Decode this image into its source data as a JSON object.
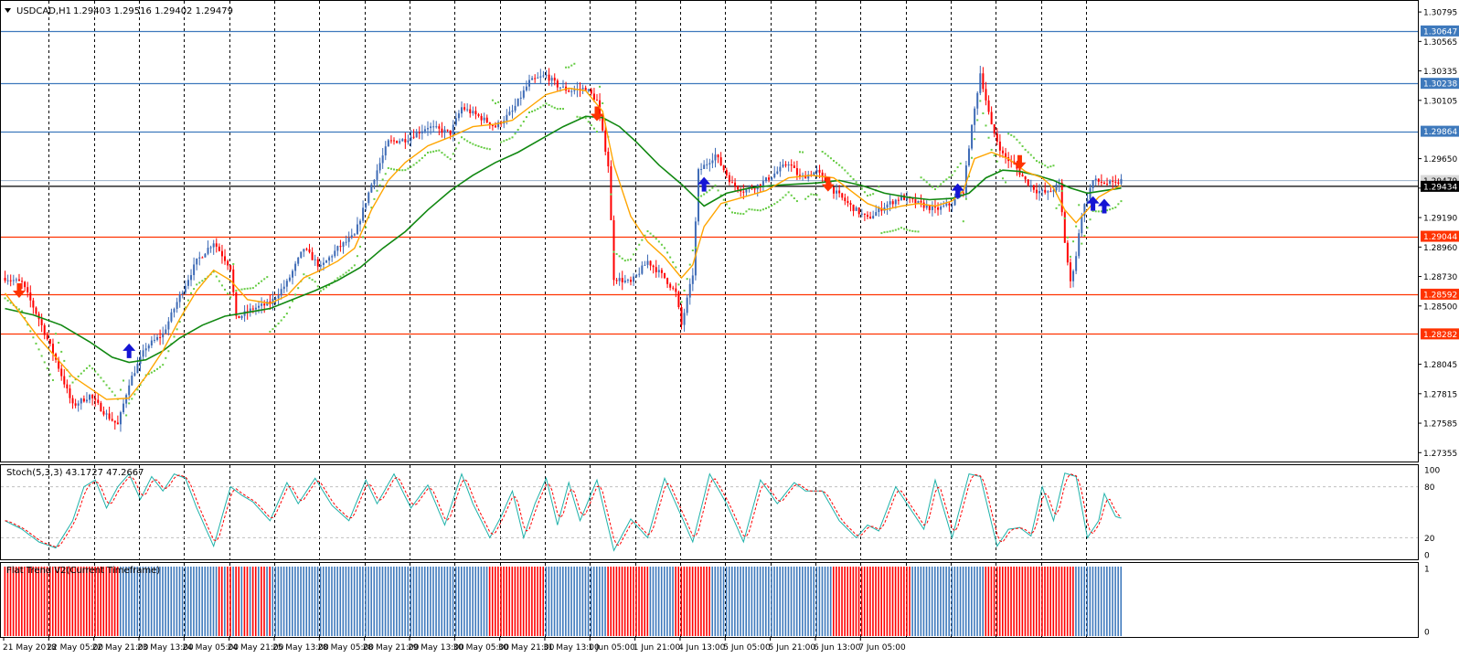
{
  "window": {
    "title": "USDCAD,H1",
    "ohlc": "1.29403 1.29516 1.29402 1.29479",
    "collapse_icon": "triangle-down-icon"
  },
  "colors": {
    "background": "#ffffff",
    "bull_candle": "#3e6bb6",
    "bear_candle": "#ff0000",
    "ma_fast": "#ffa500",
    "ma_slow": "#118811",
    "sar": "#66cc44",
    "resistance": "#3e79bc",
    "support": "#ff3300",
    "bid_line": "#000000",
    "arrow_up": "#1515d4",
    "arrow_down": "#ff3300",
    "stoch_main": "#20b2aa",
    "stoch_signal": "#ff0000",
    "flat_up": "#3e79bc",
    "flat_down": "#ff0000"
  },
  "chart_data": [
    {
      "type": "candlestick",
      "name": "USDCAD H1",
      "price_scale": [
        "1.30795",
        "1.30565",
        "1.30335",
        "1.30105",
        "1.29650",
        "1.29420",
        "1.29190",
        "1.28960",
        "1.28730",
        "1.28500",
        "1.28045",
        "1.27815",
        "1.27585",
        "1.27355"
      ],
      "ylim": [
        1.273,
        1.3086
      ],
      "horizontal_levels": [
        {
          "label": "1.30647",
          "value": 1.30647,
          "kind": "resistance"
        },
        {
          "label": "1.30238",
          "value": 1.30238,
          "kind": "resistance"
        },
        {
          "label": "1.29864",
          "value": 1.29864,
          "kind": "resistance"
        },
        {
          "label": "1.29044",
          "value": 1.29044,
          "kind": "support"
        },
        {
          "label": "1.28592",
          "value": 1.28592,
          "kind": "support"
        },
        {
          "label": "1.28282",
          "value": 1.28282,
          "kind": "support"
        }
      ],
      "bid": {
        "label": "1.29434",
        "value": 1.29434
      },
      "ask": {
        "label": "1.29479",
        "value": 1.29479
      },
      "x_labels": [
        "21 May 2018",
        "22 May 05:00",
        "22 May 21:00",
        "23 May 13:00",
        "24 May 05:00",
        "24 May 21:00",
        "25 May 13:00",
        "28 May 05:00",
        "28 May 21:00",
        "29 May 13:00",
        "30 May 05:00",
        "30 May 21:00",
        "31 May 13:00",
        "1 Jun 05:00",
        "1 Jun 21:00",
        "4 Jun 13:00",
        "5 Jun 05:00",
        "5 Jun 21:00",
        "6 Jun 13:00",
        "7 Jun 05:00"
      ],
      "close_path": [
        [
          0,
          1.2872
        ],
        [
          6,
          1.2868
        ],
        [
          12,
          1.284
        ],
        [
          18,
          1.2808
        ],
        [
          24,
          1.2772
        ],
        [
          30,
          1.278
        ],
        [
          36,
          1.2765
        ],
        [
          40,
          1.2757
        ],
        [
          44,
          1.279
        ],
        [
          50,
          1.2818
        ],
        [
          56,
          1.2828
        ],
        [
          62,
          1.2858
        ],
        [
          68,
          1.2885
        ],
        [
          74,
          1.29
        ],
        [
          80,
          1.288
        ],
        [
          82,
          1.284
        ],
        [
          88,
          1.2848
        ],
        [
          94,
          1.2852
        ],
        [
          100,
          1.2868
        ],
        [
          106,
          1.2895
        ],
        [
          112,
          1.288
        ],
        [
          118,
          1.2895
        ],
        [
          124,
          1.2905
        ],
        [
          130,
          1.2945
        ],
        [
          136,
          1.2978
        ],
        [
          142,
          1.298
        ],
        [
          150,
          1.299
        ],
        [
          158,
          1.2985
        ],
        [
          162,
          1.3005
        ],
        [
          168,
          1.2998
        ],
        [
          174,
          1.299
        ],
        [
          180,
          1.3002
        ],
        [
          186,
          1.3025
        ],
        [
          192,
          1.303
        ],
        [
          196,
          1.3022
        ],
        [
          200,
          1.3018
        ],
        [
          206,
          1.302
        ],
        [
          210,
          1.301
        ],
        [
          214,
          1.296
        ],
        [
          216,
          1.2872
        ],
        [
          222,
          1.2868
        ],
        [
          228,
          1.2885
        ],
        [
          234,
          1.2872
        ],
        [
          238,
          1.286
        ],
        [
          240,
          1.2835
        ],
        [
          244,
          1.2875
        ],
        [
          246,
          1.2955
        ],
        [
          252,
          1.2968
        ],
        [
          258,
          1.2945
        ],
        [
          262,
          1.294
        ],
        [
          268,
          1.2945
        ],
        [
          274,
          1.2955
        ],
        [
          278,
          1.2962
        ],
        [
          282,
          1.295
        ],
        [
          288,
          1.2955
        ],
        [
          294,
          1.294
        ],
        [
          300,
          1.2928
        ],
        [
          306,
          1.2918
        ],
        [
          312,
          1.2928
        ],
        [
          318,
          1.2935
        ],
        [
          324,
          1.293
        ],
        [
          330,
          1.2925
        ],
        [
          336,
          1.293
        ],
        [
          340,
          1.294
        ],
        [
          342,
          1.2975
        ],
        [
          346,
          1.3032
        ],
        [
          350,
          1.299
        ],
        [
          354,
          1.2968
        ],
        [
          358,
          1.296
        ],
        [
          362,
          1.2948
        ],
        [
          366,
          1.294
        ],
        [
          370,
          1.2938
        ],
        [
          374,
          1.2945
        ],
        [
          376,
          1.29
        ],
        [
          378,
          1.2868
        ],
        [
          380,
          1.289
        ],
        [
          382,
          1.2922
        ],
        [
          386,
          1.2948
        ],
        [
          390,
          1.2946
        ],
        [
          394,
          1.2945
        ],
        [
          396,
          1.2948
        ]
      ],
      "ma_fast_path": [
        [
          0,
          1.286
        ],
        [
          12,
          1.2825
        ],
        [
          24,
          1.2795
        ],
        [
          36,
          1.2777
        ],
        [
          44,
          1.2778
        ],
        [
          50,
          1.2795
        ],
        [
          56,
          1.2815
        ],
        [
          62,
          1.284
        ],
        [
          68,
          1.2862
        ],
        [
          74,
          1.2878
        ],
        [
          80,
          1.287
        ],
        [
          86,
          1.2855
        ],
        [
          94,
          1.2852
        ],
        [
          100,
          1.2858
        ],
        [
          106,
          1.2872
        ],
        [
          112,
          1.2878
        ],
        [
          118,
          1.2885
        ],
        [
          124,
          1.2895
        ],
        [
          130,
          1.2925
        ],
        [
          136,
          1.2948
        ],
        [
          142,
          1.2962
        ],
        [
          150,
          1.2975
        ],
        [
          158,
          1.2982
        ],
        [
          166,
          1.299
        ],
        [
          174,
          1.2992
        ],
        [
          180,
          1.2995
        ],
        [
          186,
          1.3005
        ],
        [
          192,
          1.3015
        ],
        [
          200,
          1.302
        ],
        [
          206,
          1.3018
        ],
        [
          212,
          1.3002
        ],
        [
          216,
          1.296
        ],
        [
          222,
          1.292
        ],
        [
          228,
          1.29
        ],
        [
          234,
          1.2888
        ],
        [
          240,
          1.2872
        ],
        [
          244,
          1.2882
        ],
        [
          248,
          1.2912
        ],
        [
          254,
          1.293
        ],
        [
          262,
          1.2935
        ],
        [
          270,
          1.294
        ],
        [
          278,
          1.295
        ],
        [
          286,
          1.2952
        ],
        [
          294,
          1.295
        ],
        [
          300,
          1.294
        ],
        [
          306,
          1.293
        ],
        [
          312,
          1.2925
        ],
        [
          318,
          1.2928
        ],
        [
          324,
          1.293
        ],
        [
          330,
          1.2928
        ],
        [
          336,
          1.2932
        ],
        [
          340,
          1.294
        ],
        [
          344,
          1.2965
        ],
        [
          350,
          1.297
        ],
        [
          356,
          1.2965
        ],
        [
          362,
          1.2955
        ],
        [
          368,
          1.295
        ],
        [
          372,
          1.2942
        ],
        [
          376,
          1.2925
        ],
        [
          380,
          1.2915
        ],
        [
          384,
          1.2925
        ],
        [
          388,
          1.2935
        ],
        [
          392,
          1.294
        ],
        [
          396,
          1.2944
        ]
      ],
      "ma_slow_path": [
        [
          0,
          1.2848
        ],
        [
          10,
          1.2843
        ],
        [
          20,
          1.2835
        ],
        [
          30,
          1.2822
        ],
        [
          38,
          1.281
        ],
        [
          44,
          1.2806
        ],
        [
          50,
          1.2808
        ],
        [
          56,
          1.2815
        ],
        [
          62,
          1.2825
        ],
        [
          70,
          1.2835
        ],
        [
          78,
          1.2842
        ],
        [
          86,
          1.2845
        ],
        [
          94,
          1.2848
        ],
        [
          102,
          1.2855
        ],
        [
          110,
          1.2862
        ],
        [
          118,
          1.287
        ],
        [
          126,
          1.288
        ],
        [
          134,
          1.2895
        ],
        [
          142,
          1.2908
        ],
        [
          150,
          1.2925
        ],
        [
          158,
          1.294
        ],
        [
          166,
          1.2952
        ],
        [
          174,
          1.2962
        ],
        [
          182,
          1.297
        ],
        [
          190,
          1.298
        ],
        [
          198,
          1.299
        ],
        [
          206,
          1.2998
        ],
        [
          212,
          1.2997
        ],
        [
          218,
          1.299
        ],
        [
          224,
          1.2978
        ],
        [
          232,
          1.296
        ],
        [
          240,
          1.2945
        ],
        [
          248,
          1.2928
        ],
        [
          256,
          1.2938
        ],
        [
          264,
          1.2942
        ],
        [
          272,
          1.2944
        ],
        [
          280,
          1.2945
        ],
        [
          288,
          1.2946
        ],
        [
          296,
          1.2948
        ],
        [
          304,
          1.2944
        ],
        [
          312,
          1.2938
        ],
        [
          320,
          1.2935
        ],
        [
          328,
          1.2933
        ],
        [
          336,
          1.2934
        ],
        [
          342,
          1.2938
        ],
        [
          348,
          1.295
        ],
        [
          354,
          1.2956
        ],
        [
          360,
          1.2955
        ],
        [
          366,
          1.2952
        ],
        [
          372,
          1.2948
        ],
        [
          378,
          1.2942
        ],
        [
          384,
          1.2938
        ],
        [
          390,
          1.294
        ],
        [
          396,
          1.2942
        ]
      ],
      "signal_arrows": [
        {
          "bar": 5,
          "value": 1.2862,
          "dir": "down"
        },
        {
          "bar": 44,
          "value": 1.2815,
          "dir": "up"
        },
        {
          "bar": 210,
          "value": 1.3,
          "dir": "down"
        },
        {
          "bar": 248,
          "value": 1.2945,
          "dir": "up"
        },
        {
          "bar": 292,
          "value": 1.2945,
          "dir": "down"
        },
        {
          "bar": 338,
          "value": 1.294,
          "dir": "up"
        },
        {
          "bar": 360,
          "value": 1.2962,
          "dir": "down"
        },
        {
          "bar": 386,
          "value": 1.293,
          "dir": "up"
        },
        {
          "bar": 390,
          "value": 1.2928,
          "dir": "up"
        }
      ]
    },
    {
      "type": "line",
      "title": "Stoch(5,3,3) 43.1727 47.2667",
      "ylim": [
        0,
        100
      ],
      "levels": [
        "100",
        "80",
        "20",
        "0"
      ],
      "level_values": [
        100,
        80,
        20,
        0
      ],
      "pivots": [
        [
          0,
          40
        ],
        [
          6,
          30
        ],
        [
          12,
          15
        ],
        [
          18,
          8
        ],
        [
          24,
          40
        ],
        [
          28,
          80
        ],
        [
          32,
          88
        ],
        [
          36,
          55
        ],
        [
          40,
          80
        ],
        [
          44,
          95
        ],
        [
          48,
          65
        ],
        [
          52,
          92
        ],
        [
          56,
          75
        ],
        [
          60,
          95
        ],
        [
          64,
          90
        ],
        [
          68,
          55
        ],
        [
          74,
          10
        ],
        [
          80,
          80
        ],
        [
          84,
          70
        ],
        [
          88,
          62
        ],
        [
          94,
          40
        ],
        [
          100,
          85
        ],
        [
          104,
          60
        ],
        [
          110,
          90
        ],
        [
          116,
          58
        ],
        [
          122,
          40
        ],
        [
          128,
          88
        ],
        [
          132,
          60
        ],
        [
          138,
          95
        ],
        [
          144,
          55
        ],
        [
          150,
          82
        ],
        [
          156,
          35
        ],
        [
          162,
          95
        ],
        [
          166,
          60
        ],
        [
          172,
          20
        ],
        [
          176,
          45
        ],
        [
          180,
          75
        ],
        [
          184,
          20
        ],
        [
          188,
          60
        ],
        [
          192,
          90
        ],
        [
          196,
          35
        ],
        [
          200,
          85
        ],
        [
          204,
          40
        ],
        [
          210,
          88
        ],
        [
          216,
          5
        ],
        [
          222,
          42
        ],
        [
          228,
          20
        ],
        [
          234,
          90
        ],
        [
          238,
          60
        ],
        [
          244,
          15
        ],
        [
          250,
          95
        ],
        [
          256,
          60
        ],
        [
          262,
          15
        ],
        [
          268,
          88
        ],
        [
          274,
          60
        ],
        [
          280,
          85
        ],
        [
          284,
          75
        ],
        [
          290,
          75
        ],
        [
          296,
          40
        ],
        [
          302,
          20
        ],
        [
          306,
          35
        ],
        [
          310,
          28
        ],
        [
          316,
          80
        ],
        [
          322,
          50
        ],
        [
          326,
          30
        ],
        [
          330,
          88
        ],
        [
          336,
          20
        ],
        [
          342,
          95
        ],
        [
          346,
          92
        ],
        [
          352,
          10
        ],
        [
          356,
          30
        ],
        [
          360,
          32
        ],
        [
          364,
          22
        ],
        [
          368,
          80
        ],
        [
          372,
          40
        ],
        [
          376,
          96
        ],
        [
          380,
          92
        ],
        [
          384,
          20
        ],
        [
          388,
          40
        ],
        [
          390,
          72
        ],
        [
          394,
          45
        ],
        [
          396,
          43
        ]
      ]
    },
    {
      "type": "bar",
      "title": "Flat Trend V2(Current Timeframe)",
      "ylim": [
        0,
        1
      ],
      "levels": [
        "1",
        "0"
      ],
      "level_values": [
        1,
        0
      ],
      "segments": [
        {
          "from": 0,
          "to": 41,
          "state": "down"
        },
        {
          "from": 41,
          "to": 76,
          "state": "up"
        },
        {
          "from": 76,
          "to": 95,
          "state": "mixed"
        },
        {
          "from": 95,
          "to": 172,
          "state": "up"
        },
        {
          "from": 172,
          "to": 192,
          "state": "down"
        },
        {
          "from": 192,
          "to": 214,
          "state": "up"
        },
        {
          "from": 214,
          "to": 229,
          "state": "down"
        },
        {
          "from": 229,
          "to": 238,
          "state": "up"
        },
        {
          "from": 238,
          "to": 251,
          "state": "down"
        },
        {
          "from": 251,
          "to": 294,
          "state": "up"
        },
        {
          "from": 294,
          "to": 322,
          "state": "down"
        },
        {
          "from": 322,
          "to": 348,
          "state": "up"
        },
        {
          "from": 348,
          "to": 380,
          "state": "down"
        },
        {
          "from": 380,
          "to": 397,
          "state": "up"
        }
      ]
    }
  ]
}
